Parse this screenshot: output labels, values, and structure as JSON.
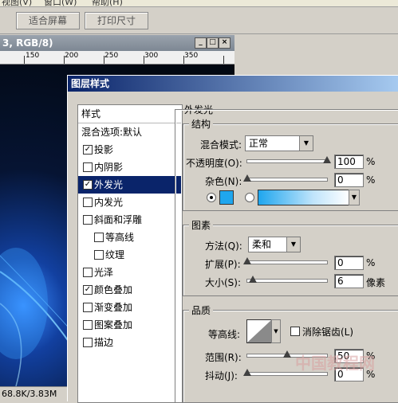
{
  "menubar": {
    "items": [
      "视图(V)",
      "窗口(W)",
      "帮助(H)"
    ]
  },
  "toolbar": {
    "fit_screen_label": "适合屏幕",
    "print_size_label": "打印尺寸"
  },
  "document": {
    "title": "3, RGB/8)",
    "ruler_labels": [
      "150",
      "200",
      "250",
      "300",
      "350"
    ],
    "status": "68.8K/3.83M",
    "window_buttons": [
      "_",
      "□",
      "×"
    ]
  },
  "dialog": {
    "title": "图层样式",
    "style_list": [
      {
        "label": "样式",
        "checkbox": false,
        "checked": false,
        "indent": false,
        "selected": false
      },
      {
        "label": "混合选项:默认",
        "checkbox": false,
        "checked": false,
        "indent": false,
        "selected": false
      },
      {
        "label": "投影",
        "checkbox": true,
        "checked": true,
        "indent": false,
        "selected": false
      },
      {
        "label": "内阴影",
        "checkbox": true,
        "checked": false,
        "indent": false,
        "selected": false
      },
      {
        "label": "外发光",
        "checkbox": true,
        "checked": true,
        "indent": false,
        "selected": true
      },
      {
        "label": "内发光",
        "checkbox": true,
        "checked": false,
        "indent": false,
        "selected": false
      },
      {
        "label": "斜面和浮雕",
        "checkbox": true,
        "checked": false,
        "indent": false,
        "selected": false
      },
      {
        "label": "等高线",
        "checkbox": true,
        "checked": false,
        "indent": true,
        "selected": false
      },
      {
        "label": "纹理",
        "checkbox": true,
        "checked": false,
        "indent": true,
        "selected": false
      },
      {
        "label": "光泽",
        "checkbox": true,
        "checked": false,
        "indent": false,
        "selected": false
      },
      {
        "label": "颜色叠加",
        "checkbox": true,
        "checked": true,
        "indent": false,
        "selected": false
      },
      {
        "label": "渐变叠加",
        "checkbox": true,
        "checked": false,
        "indent": false,
        "selected": false
      },
      {
        "label": "图案叠加",
        "checkbox": true,
        "checked": false,
        "indent": false,
        "selected": false
      },
      {
        "label": "描边",
        "checkbox": true,
        "checked": false,
        "indent": false,
        "selected": false
      }
    ],
    "outer_glow": {
      "title": "外发光",
      "structure": {
        "title": "结构",
        "blend_mode_label": "混合模式:",
        "blend_mode_value": "正常",
        "opacity_label": "不透明度(O):",
        "opacity_value": "100",
        "opacity_unit": "%",
        "noise_label": "杂色(N):",
        "noise_value": "0",
        "noise_unit": "%",
        "glow_color": "#1fa6ee",
        "solid_color_selected": true
      },
      "elements": {
        "title": "图素",
        "method_label": "方法(Q):",
        "method_value": "柔和",
        "spread_label": "扩展(P):",
        "spread_value": "0",
        "spread_unit": "%",
        "size_label": "大小(S):",
        "size_value": "6",
        "size_unit": "像素"
      },
      "quality": {
        "title": "品质",
        "contour_label": "等高线:",
        "anti_alias_label": "消除锯齿(L)",
        "anti_alias_checked": false,
        "range_label": "范围(R):",
        "range_value": "50",
        "range_unit": "%",
        "jitter_label": "抖动(J):",
        "jitter_value": "0",
        "jitter_unit": "%"
      }
    }
  },
  "watermark": {
    "text": "中国教程网"
  }
}
